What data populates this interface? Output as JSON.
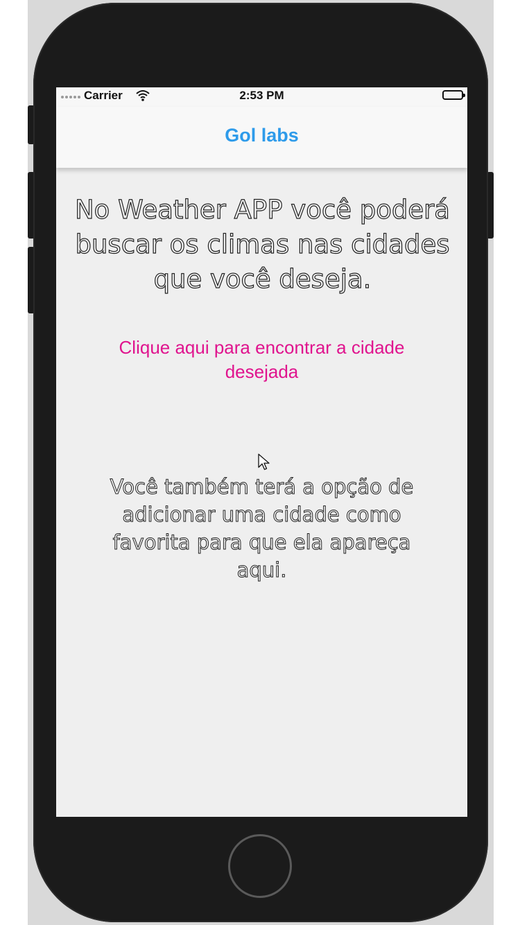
{
  "status_bar": {
    "carrier": "Carrier",
    "time": "2:53 PM",
    "icons": [
      "signal-dots-icon",
      "wifi-icon",
      "battery-icon"
    ]
  },
  "nav_bar": {
    "title": "Gol labs"
  },
  "content": {
    "intro_text": "No Weather APP você poderá buscar os climas nas cidades que você deseja.",
    "find_city_link": "Clique aqui para encontrar a cidade desejada",
    "favorite_note": "Você também terá a opção de adicionar uma cidade como favorita para que ela apareça aqui."
  },
  "colors": {
    "nav_title": "#2e9bea",
    "link": "#e0148e",
    "background": "#efefef",
    "device_body": "#1b1b1b"
  }
}
